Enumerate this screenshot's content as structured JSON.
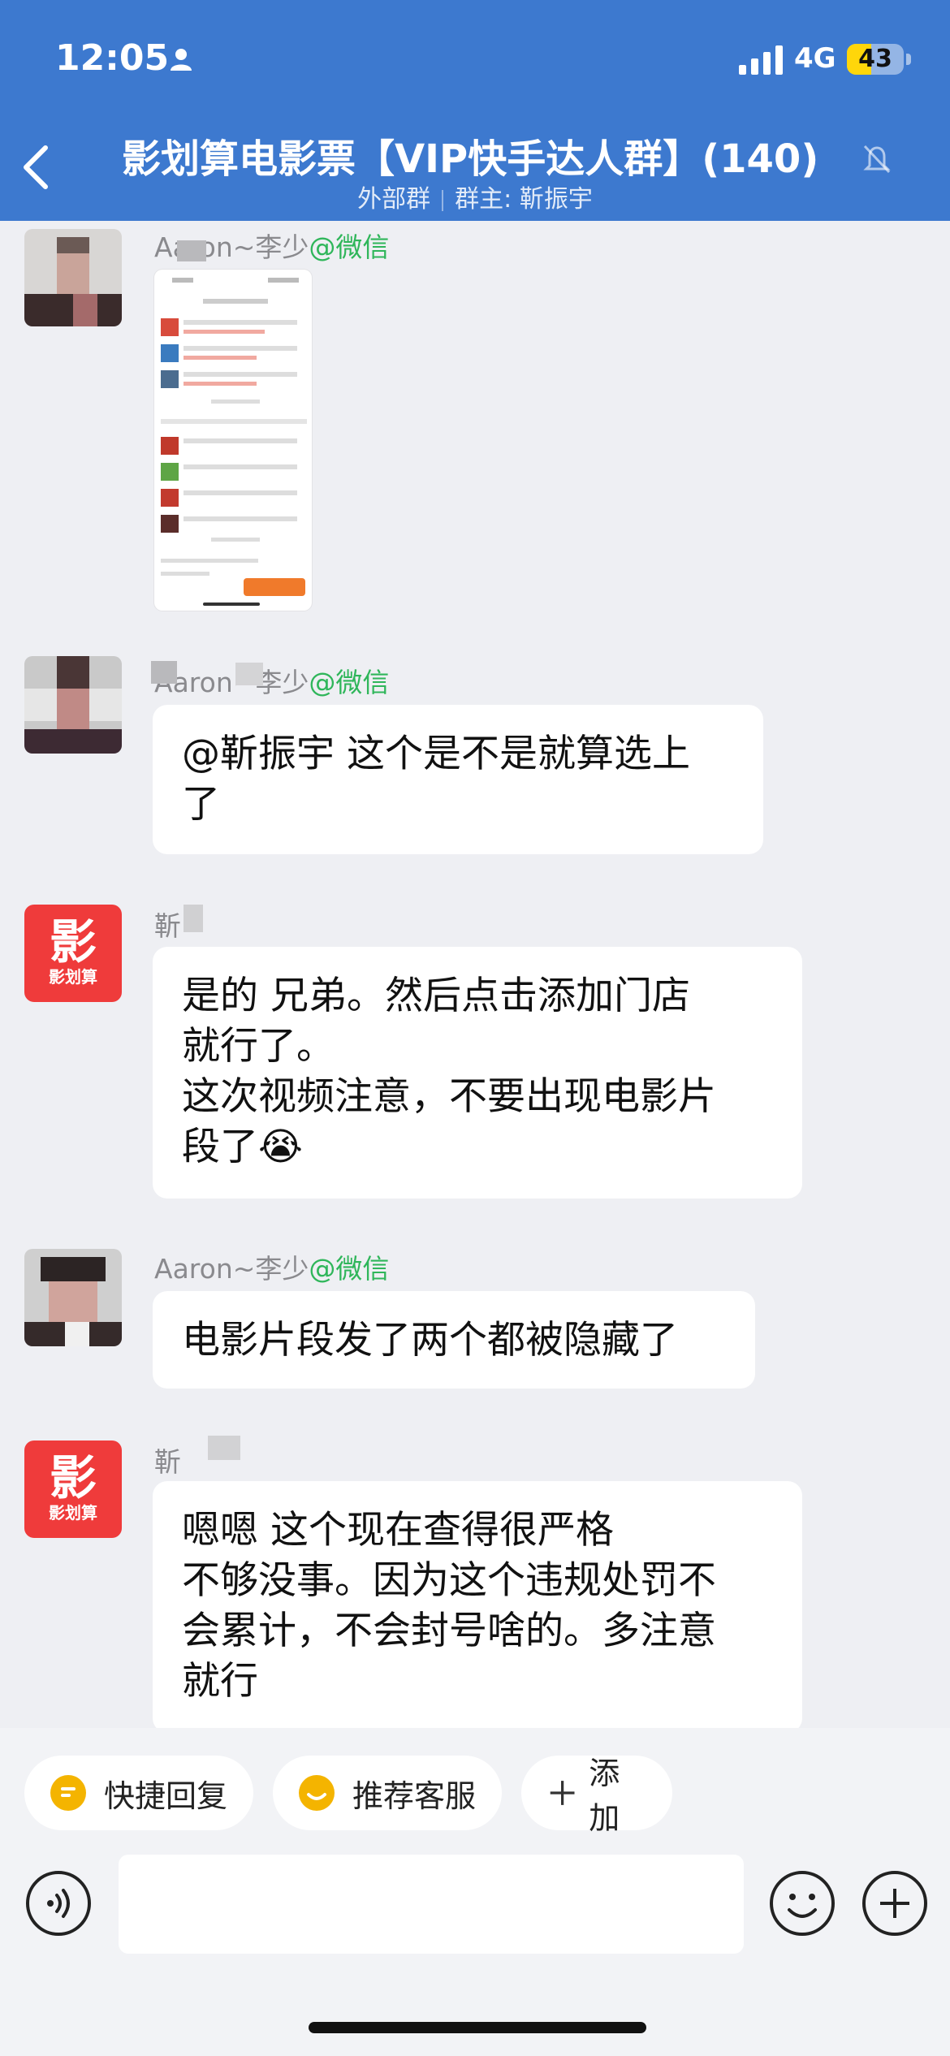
{
  "status_bar": {
    "time": "12:05",
    "network": "4G",
    "battery": "43",
    "battery_level": 0.43
  },
  "header": {
    "title": "影划算电影票【VIP快手达人群】(140)",
    "tag": "外部群",
    "owner": "群主: 靳振宇"
  },
  "messages": [
    {
      "sender": "Aaron~李少",
      "source": "@微信",
      "type": "image"
    },
    {
      "sender": "Aaron~李少",
      "source": "@微信",
      "lines": [
        "@靳振宇 这个是不是就算选上",
        "了"
      ]
    },
    {
      "sender": "靳",
      "lines": [
        "是的 兄弟。然后点击添加门店",
        "就行了。",
        "这次视频注意，不要出现电影片",
        "段了😭"
      ]
    },
    {
      "sender": "Aaron~李少",
      "source": "@微信",
      "lines": [
        "电影片段发了两个都被隐藏了"
      ]
    },
    {
      "sender": "靳",
      "lines": [
        "嗯嗯 这个现在查得很严格",
        "不够没事。因为这个违规处罚不",
        "会累计，不会封号啥的。多注意",
        "就行"
      ]
    }
  ],
  "brand_avatar": {
    "glyph": "影",
    "caption": "影划算"
  },
  "quick_actions": [
    "快捷回复",
    "推荐客服",
    "添加"
  ],
  "composer": {
    "placeholder": ""
  },
  "colors": {
    "header_bg": "#3d79cf",
    "wechat_green": "#2fb65a",
    "brand_red": "#ef3b3b"
  }
}
